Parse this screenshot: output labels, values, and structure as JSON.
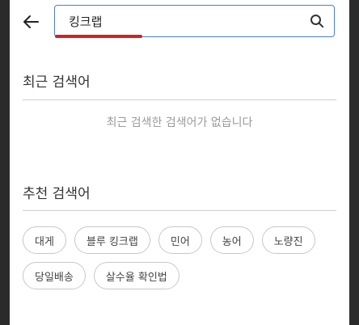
{
  "header": {
    "back_icon": "arrow-left-icon",
    "search_value": "킹크랩",
    "search_icon": "search-icon",
    "accent_color": "#4a7fc7",
    "highlight_color": "#d42020"
  },
  "recent": {
    "title": "최근 검색어",
    "empty_message": "최근 검색한 검색어가 없습니다"
  },
  "recommended": {
    "title": "추천 검색어",
    "chips": [
      "대게",
      "블루 킹크랩",
      "민어",
      "농어",
      "노량진",
      "당일배송",
      "살수율 확인법"
    ]
  }
}
